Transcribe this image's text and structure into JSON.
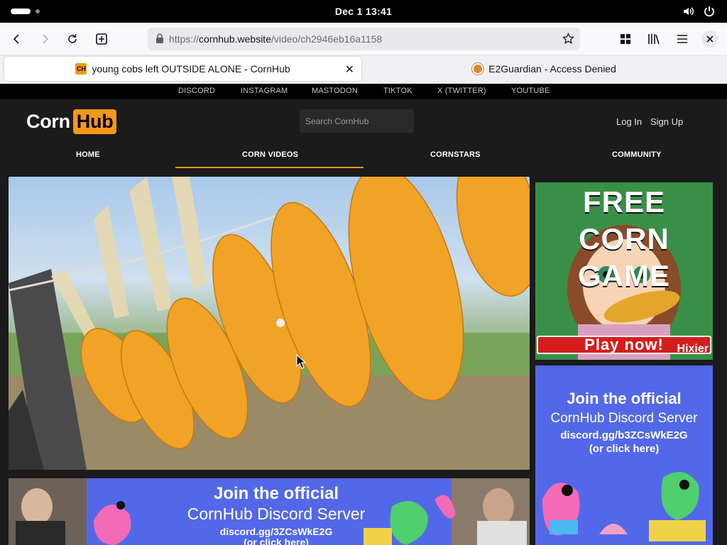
{
  "system": {
    "clock": "Dec 1  13:41"
  },
  "browser": {
    "url_prefix": "https://",
    "url_host": "cornhub.website",
    "url_path": "/video/ch2946eb16a1158",
    "tabs": [
      {
        "title": "young cobs left OUTSIDE ALONE - CornHub",
        "favicon": "CH",
        "active": true
      },
      {
        "title": "E2Guardian - Access Denied",
        "active": false
      }
    ]
  },
  "site": {
    "social_links": [
      "DISCORD",
      "INSTAGRAM",
      "MASTODON",
      "TIKTOK",
      "X (TWITTER)",
      "YOUTUBE"
    ],
    "logo": {
      "part1": "Corn",
      "part2": "Hub"
    },
    "search_placeholder": "Search CornHub",
    "login": "Log In",
    "signup": "Sign Up",
    "nav": [
      "HOME",
      "CORN VIDEOS",
      "CORNSTARS",
      "COMMUNITY"
    ],
    "active_nav": "CORN VIDEOS",
    "accent_color": "#f7971d"
  },
  "ads": {
    "game": {
      "title": "FREE CORN GAME",
      "button": "Play now!",
      "brand": "Hixier"
    },
    "discord_side": {
      "title": "Join the official",
      "subtitle": "CornHub Discord Server",
      "link": "discord.gg/b3ZCsWkE2G",
      "click": "(or click here)"
    },
    "discord_banner": {
      "title": "Join the official",
      "subtitle": "CornHub Discord Server",
      "link": "discord.gg/3ZCsWkE2G",
      "click": "(or click here)"
    }
  }
}
